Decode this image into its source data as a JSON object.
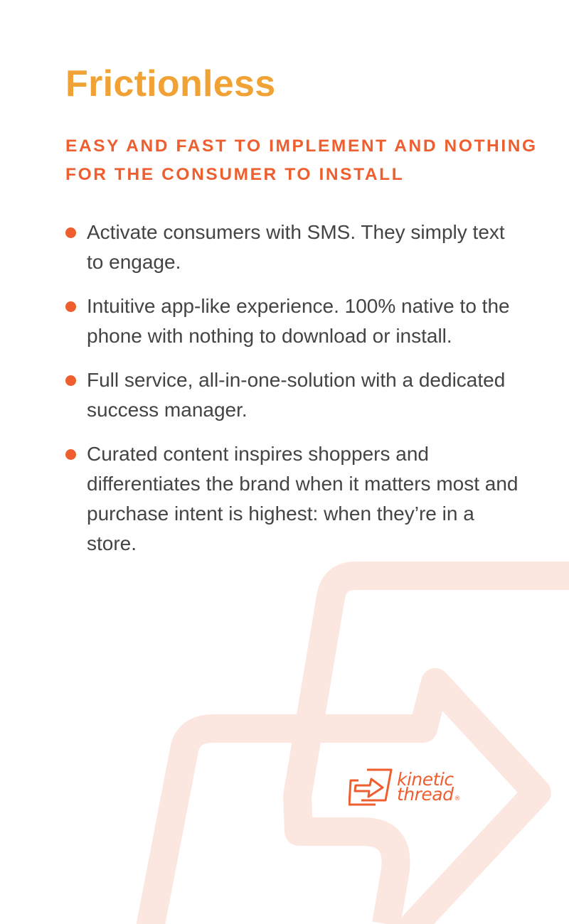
{
  "heading": "Frictionless",
  "subheading": "Easy and fast to implement and nothing for the consumer to install",
  "bullets": [
    {
      "text": "Activate consumers with SMS. They simply text to engage."
    },
    {
      "text": "Intuitive app-like experience. 100% native to the phone with nothing to download or install."
    },
    {
      "text": "Full service, all-in-one-solution with a dedicated success manager."
    },
    {
      "text": "Curated content inspires shoppers and differentiates the brand when it matters most and purchase intent is highest: when they’re in a store."
    }
  ],
  "logo": {
    "line1": "kinetic",
    "line2": "thread",
    "registered": "®",
    "mark_icon": "arrow-in-box-icon"
  },
  "colors": {
    "heading": "#f0a235",
    "accent": "#ee5e2e",
    "body_text": "#444444",
    "background_shape": "#fbe7df",
    "background": "#ffffff"
  }
}
